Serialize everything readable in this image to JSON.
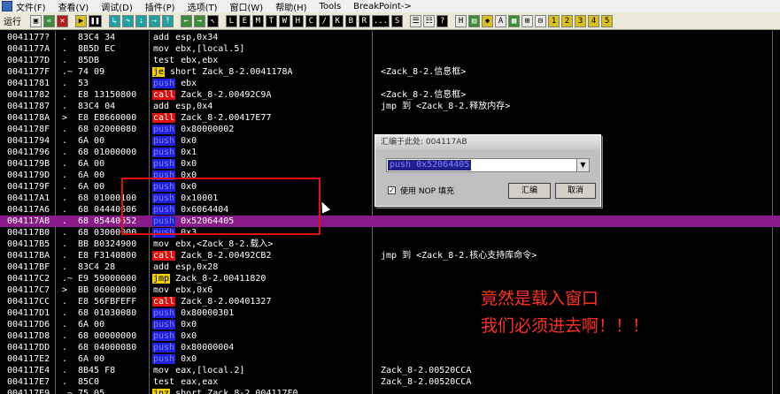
{
  "menubar": {
    "items": [
      "文件(F)",
      "查看(V)",
      "调试(D)",
      "插件(P)",
      "选项(T)",
      "窗口(W)",
      "帮助(H)",
      "Tools",
      "BreakPoint->"
    ]
  },
  "toolbar": {
    "run_label": "运行",
    "letters": [
      "L",
      "E",
      "M",
      "T",
      "W",
      "H",
      "C",
      "/",
      "K",
      "B",
      "R",
      "...",
      "S"
    ]
  },
  "rows": [
    {
      "addr": "0041177?",
      "mark": ".",
      "hex": "83C4 34",
      "mn": "add",
      "kind": "",
      "ops": "esp,0x34",
      "cmt": ""
    },
    {
      "addr": "0041177A",
      "mark": ".",
      "hex": "8B5D EC",
      "mn": "mov",
      "kind": "",
      "ops": "ebx,[local.5]",
      "cmt": ""
    },
    {
      "addr": "0041177D",
      "mark": ".",
      "hex": "85DB",
      "mn": "test",
      "kind": "",
      "ops": "ebx,ebx",
      "cmt": ""
    },
    {
      "addr": "0041177F",
      "mark": ".~",
      "hex": "74 09",
      "mn": "je",
      "kind": "jcc",
      "ops": "short Zack_8-2.0041178A",
      "cmt": "<Zack_8-2.信息框>"
    },
    {
      "addr": "00411781",
      "mark": ".",
      "hex": "53",
      "mn": "push",
      "kind": "push",
      "ops": "ebx",
      "cmt": ""
    },
    {
      "addr": "00411782",
      "mark": ".",
      "hex": "E8 13150800",
      "mn": "call",
      "kind": "call",
      "ops": "Zack_8-2.00492C9A",
      "cmt": "<Zack_8-2.信息框>"
    },
    {
      "addr": "00411787",
      "mark": ".",
      "hex": "83C4 04",
      "mn": "add",
      "kind": "",
      "ops": "esp,0x4",
      "cmt": "jmp 到 <Zack_8-2.释放内存>"
    },
    {
      "addr": "0041178A",
      "mark": ">",
      "hex": "E8 E8660000",
      "mn": "call",
      "kind": "call",
      "ops": "Zack_8-2.00417E77",
      "cmt": ""
    },
    {
      "addr": "0041178F",
      "mark": ".",
      "hex": "68 02000080",
      "mn": "push",
      "kind": "push",
      "ops": "0x80000002",
      "cmt": ""
    },
    {
      "addr": "00411794",
      "mark": ".",
      "hex": "6A 00",
      "mn": "push",
      "kind": "push",
      "ops": "0x0",
      "cmt": ""
    },
    {
      "addr": "00411796",
      "mark": ".",
      "hex": "68 01000000",
      "mn": "push",
      "kind": "push",
      "ops": "0x1",
      "cmt": ""
    },
    {
      "addr": "0041179B",
      "mark": ".",
      "hex": "6A 00",
      "mn": "push",
      "kind": "push",
      "ops": "0x0",
      "cmt": ""
    },
    {
      "addr": "0041179D",
      "mark": ".",
      "hex": "6A 00",
      "mn": "push",
      "kind": "push",
      "ops": "0x0",
      "cmt": ""
    },
    {
      "addr": "0041179F",
      "mark": ".",
      "hex": "6A 00",
      "mn": "push",
      "kind": "push",
      "ops": "0x0",
      "cmt": ""
    },
    {
      "addr": "004117A1",
      "mark": ".",
      "hex": "68 01000100",
      "mn": "push",
      "kind": "push",
      "ops": "0x10001",
      "cmt": ""
    },
    {
      "addr": "004117A6",
      "mark": ".",
      "hex": "68 04440606",
      "mn": "push",
      "kind": "push",
      "ops": "0x6064404",
      "cmt": ""
    },
    {
      "addr": "004117AB",
      "mark": ".",
      "hex": "68 05440652",
      "mn": "push",
      "kind": "push",
      "ops": "0x52064405",
      "cmt": "",
      "sel": true
    },
    {
      "addr": "004117B0",
      "mark": ".",
      "hex": "68 03000000",
      "mn": "push",
      "kind": "push",
      "ops": "0x3",
      "cmt": ""
    },
    {
      "addr": "004117B5",
      "mark": ".",
      "hex": "BB B0324900",
      "mn": "mov",
      "kind": "",
      "ops": "ebx,<Zack_8-2.载入>",
      "cmt": ""
    },
    {
      "addr": "004117BA",
      "mark": ".",
      "hex": "E8 F3140800",
      "mn": "call",
      "kind": "call",
      "ops": "Zack_8-2.00492CB2",
      "cmt": "jmp 到 <Zack_8-2.核心支持库命令>"
    },
    {
      "addr": "004117BF",
      "mark": ".",
      "hex": "83C4 28",
      "mn": "add",
      "kind": "",
      "ops": "esp,0x28",
      "cmt": ""
    },
    {
      "addr": "004117C2",
      "mark": ".~",
      "hex": "E9 59000000",
      "mn": "jmp",
      "kind": "jmp",
      "ops": "Zack_8-2.00411820",
      "cmt": ""
    },
    {
      "addr": "004117C7",
      "mark": ">",
      "hex": "BB 06000000",
      "mn": "mov",
      "kind": "",
      "ops": "ebx,0x6",
      "cmt": ""
    },
    {
      "addr": "004117CC",
      "mark": ".",
      "hex": "E8 56FBFEFF",
      "mn": "call",
      "kind": "call",
      "ops": "Zack_8-2.00401327",
      "cmt": ""
    },
    {
      "addr": "004117D1",
      "mark": ".",
      "hex": "68 01030080",
      "mn": "push",
      "kind": "push",
      "ops": "0x80000301",
      "cmt": ""
    },
    {
      "addr": "004117D6",
      "mark": ".",
      "hex": "6A 00",
      "mn": "push",
      "kind": "push",
      "ops": "0x0",
      "cmt": ""
    },
    {
      "addr": "004117D8",
      "mark": ".",
      "hex": "68 00000000",
      "mn": "push",
      "kind": "push",
      "ops": "0x0",
      "cmt": ""
    },
    {
      "addr": "004117DD",
      "mark": ".",
      "hex": "68 04000080",
      "mn": "push",
      "kind": "push",
      "ops": "0x80000004",
      "cmt": ""
    },
    {
      "addr": "004117E2",
      "mark": ".",
      "hex": "6A 00",
      "mn": "push",
      "kind": "push",
      "ops": "0x0",
      "cmt": ""
    },
    {
      "addr": "004117E4",
      "mark": ".",
      "hex": "8B45 F8",
      "mn": "mov",
      "kind": "",
      "ops": "eax,[local.2]",
      "cmt": "Zack_8-2.00520CCA"
    },
    {
      "addr": "004117E7",
      "mark": ".",
      "hex": "85C0",
      "mn": "test",
      "kind": "",
      "ops": "eax,eax",
      "cmt": "Zack_8-2.00520CCA"
    },
    {
      "addr": "004117E9",
      "mark": ".~",
      "hex": "75 05",
      "mn": "jnz",
      "kind": "jcc",
      "ops": "short Zack_8-2.004117F0",
      "cmt": ""
    }
  ],
  "dialog": {
    "title": "汇编于此处: 004117AB",
    "input_value": "push 0x52064405",
    "checkbox_label": "使用 NOP 填充",
    "ok_label": "汇编",
    "cancel_label": "取消"
  },
  "annotation": {
    "line1": "竟然是载入窗口",
    "line2": "我们必须进去啊！！！"
  },
  "colors": {
    "selected_row": "#8a1a8a",
    "call_bg": "#e01010",
    "push_bg": "#2020d8",
    "jump_bg": "#f0d000",
    "annotation": "#ff3020"
  }
}
